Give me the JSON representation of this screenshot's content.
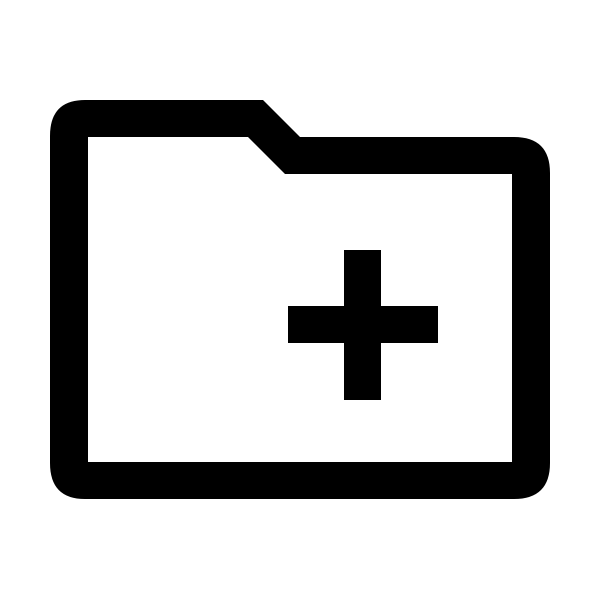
{
  "icon": {
    "name": "new-folder-icon",
    "parts": [
      "folder-outline",
      "plus-sign"
    ],
    "color": "#000000",
    "background": "#ffffff"
  }
}
